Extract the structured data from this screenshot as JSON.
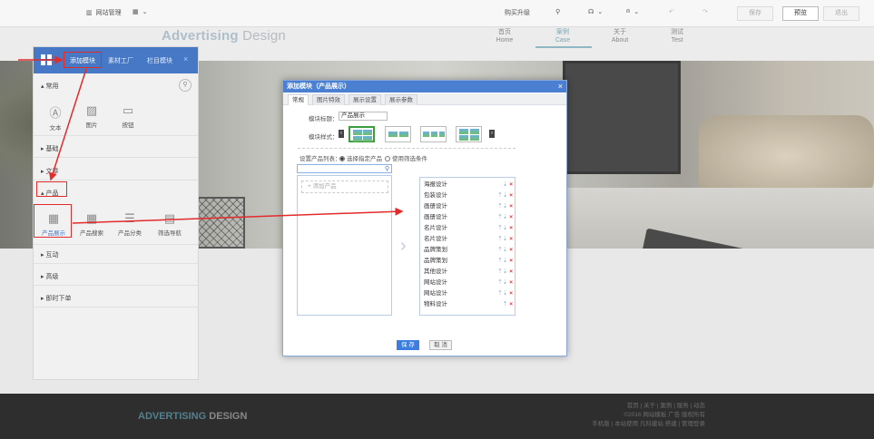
{
  "toolbar": {
    "site_manage": "网站管理",
    "buy_upgrade": "购买升级",
    "save": "保存",
    "preview": "预览",
    "exit": "退出"
  },
  "site": {
    "logo_main": "Advertising",
    "logo_sub": " Design",
    "nav": [
      {
        "cn": "首页",
        "en": "Home"
      },
      {
        "cn": "案例",
        "en": "Case"
      },
      {
        "cn": "关于",
        "en": "About"
      },
      {
        "cn": "测试",
        "en": "Test"
      }
    ]
  },
  "footer": {
    "logo_main": "ADVERTISING",
    "logo_sub": " DESIGN",
    "links": "首页 | 关于 | 案例 | 服务 | 动态",
    "copyright": "©2016 网站模板 广告 版权所有",
    "bottom": "手机版 | 本站使用 凡科建站 搭建 | 管理登录"
  },
  "module_panel": {
    "tabs": [
      "添加模块",
      "素材工厂",
      "栏目模块"
    ],
    "close": "×",
    "sections": {
      "common": "▴ 常用",
      "basic": "▸ 基础",
      "article": "▸ 文章",
      "product": "▴ 产品",
      "interact": "▸ 互动",
      "advanced": "▸ 高级",
      "download": "▸ 即时下单"
    },
    "common_items": [
      "文本",
      "图片",
      "按钮"
    ],
    "product_items": [
      "产品展示",
      "产品搜索",
      "产品分类",
      "筛选导航"
    ]
  },
  "dialog": {
    "title": "添加模块（产品展示）",
    "close": "×",
    "tabs": [
      "常规",
      "图片特效",
      "展示设置",
      "展示参数"
    ],
    "module_title_label": "模块标题：",
    "module_title_value": "产品展示",
    "module_style_label": "模块样式：",
    "product_list_label": "设置产品列表：",
    "opt_select": "选择指定产品",
    "opt_filter": "使用筛选条件",
    "add_product": "+ 添加产品",
    "products": [
      "海报设计",
      "包装设计",
      "画册设计",
      "画册设计",
      "名片设计",
      "名片设计",
      "品牌策划",
      "品牌策划",
      "其他设计",
      "网站设计",
      "网站设计",
      "物料设计"
    ],
    "save": "保 存",
    "cancel": "取 消"
  }
}
